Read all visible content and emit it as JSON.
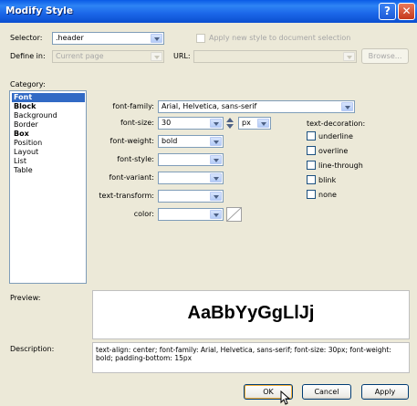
{
  "window": {
    "title": "Modify Style",
    "help_glyph": "?",
    "close_glyph": "✕"
  },
  "selector": {
    "label": "Selector:",
    "value": ".header",
    "apply_new_label": "Apply new style to document selection",
    "apply_new_checked": false
  },
  "define_in": {
    "label": "Define in:",
    "value": "Current page",
    "url_label": "URL:",
    "url_value": "",
    "browse_label": "Browse..."
  },
  "category": {
    "label": "Category:",
    "items": [
      {
        "label": "Font",
        "selected": true,
        "bold": true
      },
      {
        "label": "Block",
        "selected": false,
        "bold": true
      },
      {
        "label": "Background",
        "selected": false,
        "bold": false
      },
      {
        "label": "Border",
        "selected": false,
        "bold": false
      },
      {
        "label": "Box",
        "selected": false,
        "bold": true
      },
      {
        "label": "Position",
        "selected": false,
        "bold": false
      },
      {
        "label": "Layout",
        "selected": false,
        "bold": false
      },
      {
        "label": "List",
        "selected": false,
        "bold": false
      },
      {
        "label": "Table",
        "selected": false,
        "bold": false
      }
    ]
  },
  "font": {
    "family_label": "font-family:",
    "family_value": "Arial, Helvetica, sans-serif",
    "size_label": "font-size:",
    "size_value": "30",
    "size_unit": "px",
    "weight_label": "font-weight:",
    "weight_value": "bold",
    "style_label": "font-style:",
    "style_value": "",
    "variant_label": "font-variant:",
    "variant_value": "",
    "transform_label": "text-transform:",
    "transform_value": "",
    "color_label": "color:",
    "color_value": ""
  },
  "decoration": {
    "label": "text-decoration:",
    "options": [
      {
        "label": "underline",
        "checked": false
      },
      {
        "label": "overline",
        "checked": false
      },
      {
        "label": "line-through",
        "checked": false
      },
      {
        "label": "blink",
        "checked": false
      },
      {
        "label": "none",
        "checked": false
      }
    ]
  },
  "preview": {
    "label": "Preview:",
    "sample": "AaBbYyGgLlJj"
  },
  "description": {
    "label": "Description:",
    "text": "text-align: center; font-family: Arial, Helvetica, sans-serif; font-size: 30px; font-weight: bold; padding-bottom: 15px"
  },
  "buttons": {
    "ok": "OK",
    "cancel": "Cancel",
    "apply": "Apply"
  },
  "colors": {
    "title_bar": "#0A5BE6",
    "selection": "#316AC5",
    "dialog_bg": "#ECE9D8"
  }
}
